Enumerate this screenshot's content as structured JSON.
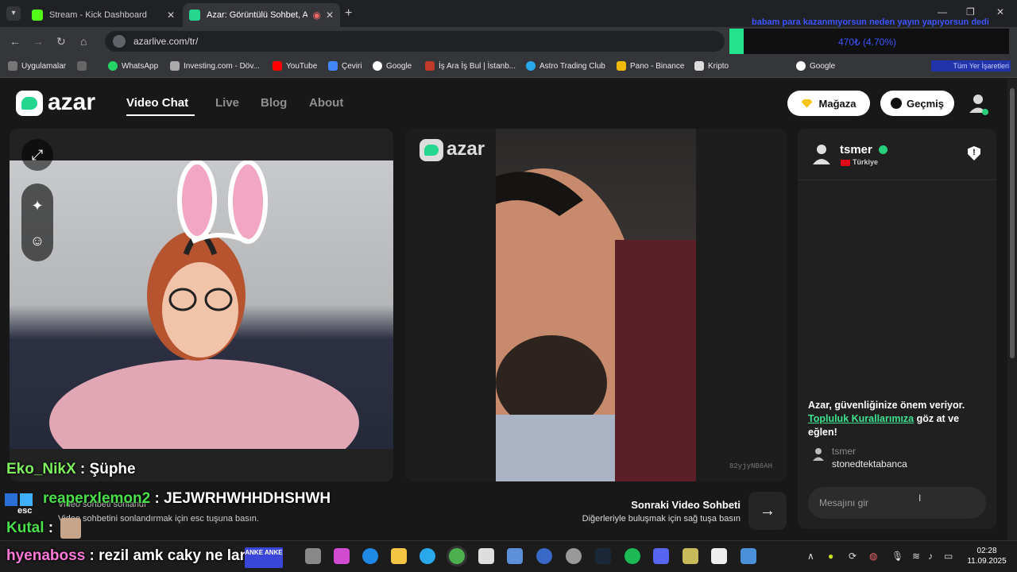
{
  "browser": {
    "tabs": [
      {
        "title": "Stream - Kick Dashboard",
        "favicon_color": "#53fc18",
        "active": false
      },
      {
        "title": "Azar: Görüntülü Sohbet, Anl",
        "favicon_color": "#24d68f",
        "active": true
      }
    ],
    "url": "azarlive.com/tr/",
    "bookmarks": [
      "Uygulamalar",
      "WhatsApp",
      "Investing.com - Döv...",
      "YouTube",
      "Çeviri",
      "Google",
      "İş Ara İş Bul | İstanb...",
      "Astro Trading Club",
      "Pano - Binance",
      "Kripto",
      "Google"
    ],
    "bookmark_right": "Tüm Yer İşaretleri"
  },
  "stream_overlay": {
    "top_ticker": "babam para kazanmıyorsun neden yayın yapıyorsun dedi",
    "progress_text": "470₺ (4.70%)",
    "progress_fraction": 0.047
  },
  "site": {
    "logo": "azar",
    "nav": [
      "Video Chat",
      "Live",
      "Blog",
      "About"
    ],
    "active_nav": "Video Chat",
    "store_button": "Mağaza",
    "history_button": "Geçmiş"
  },
  "video": {
    "watermark": "azar",
    "partner_id": "82yjyNB6AH",
    "next_title": "Sonraki Video Sohbeti",
    "next_subtitle": "Diğerleriyle buluşmak için sağ tuşa basın",
    "end_hint": "Video sohbetini sonlandırmak için esc tuşuna basın.",
    "end_hint_behind": "Video sohbeti sonlandı",
    "esc_label": "esc"
  },
  "chat_panel": {
    "partner_name": "tsmer",
    "partner_country": "Türkiye",
    "safety_prefix": "Azar, güvenliğinize önem veriyor. ",
    "safety_link": "Topluluk Kurallarımıza",
    "safety_suffix": " göz at ve eğlen!",
    "messages": [
      {
        "user": "tsmer",
        "text": "stonedtektabanca"
      }
    ],
    "input_placeholder": "Mesajını gir"
  },
  "stream_chat": [
    {
      "user": "Eko_NikX",
      "sep": " : ",
      "text": "Şüphe"
    },
    {
      "user": "reaperxlemon2",
      "sep": " : ",
      "text": "JEJWRHWHHDHSHWH"
    },
    {
      "user": "Kutal",
      "sep": " : ",
      "text": ""
    },
    {
      "user": "hyenaboss",
      "sep": " : ",
      "text": "rezil amk caky ne lan"
    }
  ],
  "emote_text": "ANKE ANKE",
  "taskbar": {
    "time": "02:28",
    "date": "11.09.2025"
  },
  "colors": {
    "accent_green": "#24d68f",
    "link_green": "#3ee28f",
    "overlay_blue": "#3b55ff"
  }
}
